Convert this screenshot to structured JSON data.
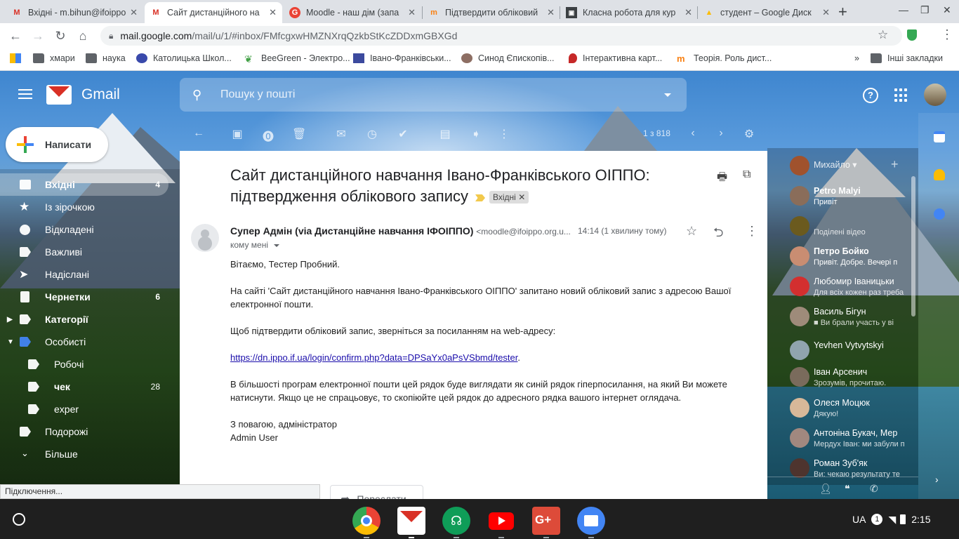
{
  "tabs": [
    {
      "title": "Вхідні - m.bihun@ifoippo",
      "icon": "gmail-icon",
      "active": false
    },
    {
      "title": "Сайт дистанційного на",
      "icon": "gmail-icon",
      "active": true
    },
    {
      "title": "Moodle - наш дім (запа",
      "icon": "google-icon",
      "active": false
    },
    {
      "title": "Підтвердити обліковий",
      "icon": "moodle-icon",
      "active": false
    },
    {
      "title": "Класна робота для кур",
      "icon": "classroom-icon",
      "active": false
    },
    {
      "title": "студент – Google Диск",
      "icon": "drive-icon",
      "active": false
    }
  ],
  "address": {
    "host": "mail.google.com",
    "path": "/mail/u/1/#inbox/FMfcgxwHMZNXrqQzkbStKcZDDxmGBXGd"
  },
  "bookmarks": [
    "хмари",
    "наука",
    "Католицька Школ...",
    "BeeGreen - Электро...",
    "Івано-Франківськи...",
    "Синод Єпископів...",
    "Інтерактивна карт...",
    "Теорія. Роль дист...",
    "Інші закладки"
  ],
  "gmail": {
    "brand": "Gmail",
    "search_placeholder": "Пошук у пошті",
    "compose_label": "Написати",
    "pager": "1 з 818",
    "nav": [
      {
        "label": "Вхідні",
        "count": "4",
        "icon": "inbox-icon",
        "selected": true
      },
      {
        "label": "Із зірочкою",
        "count": "",
        "icon": "star-icon"
      },
      {
        "label": "Відкладені",
        "count": "",
        "icon": "clock-icon"
      },
      {
        "label": "Важливі",
        "count": "",
        "icon": "label-icon"
      },
      {
        "label": "Надіслані",
        "count": "",
        "icon": "send-icon"
      },
      {
        "label": "Чернетки",
        "count": "6",
        "icon": "draft-icon",
        "bold": true
      },
      {
        "label": "Категорії",
        "count": "",
        "icon": "label-icon",
        "bold": true
      },
      {
        "label": "Особисті",
        "count": "",
        "icon": "label-icon"
      },
      {
        "label": "Робочі",
        "count": "",
        "icon": "label-icon"
      },
      {
        "label": "чек",
        "count": "28",
        "icon": "label-icon",
        "bold": true
      },
      {
        "label": "exper",
        "count": "",
        "icon": "label-icon"
      },
      {
        "label": "Подорожі",
        "count": "",
        "icon": "label-icon"
      },
      {
        "label": "Більше",
        "count": "",
        "icon": "chevron-down-icon"
      }
    ]
  },
  "message": {
    "subject": "Сайт дистанційного навчання Івано-Франківського ОІППО: підтвердження облікового запису",
    "label_chip": "Вхідні",
    "sender_name": "Супер Адмін (via Дистанційне навчання ІФОІППО)",
    "sender_email": "<moodle@ifoippo.org.u...",
    "time": "14:14 (1 хвилину тому)",
    "to": "кому мені",
    "greeting": "Вітаємо, Тестер Пробний.",
    "p1": "На сайті 'Сайт дистанційного навчання Івано-Франківського ОІППО' запитано новий обліковий запис з адресою Вашої електронної пошти.",
    "p2": "Щоб підтвердити обліковий запис, зверніться за посиланням на web-адресу:",
    "link": "https://dn.ippo.if.ua/login/confirm.php?data=DPSaYx0aPsVSbmd/tester",
    "p3": "В більшості програм електронної пошти цей рядок буде виглядати як синій рядок гіперпосилання, на який Ви можете натиснути. Якщо це не спрацьовує, то скопіюйте цей рядок до адресного рядка вашого інтернет оглядача.",
    "regards": "З повагою, адміністратор",
    "signature": "Admin User",
    "forward_label": "Переслати"
  },
  "chat": {
    "me": "Михайло",
    "contacts": [
      {
        "name": "Petro Malyi",
        "status": "Привіт",
        "bold": true
      },
      {
        "name": "",
        "status": "Поділені відео",
        "bold": false
      },
      {
        "name": "Петро Бойко",
        "status": "Привіт. Добре. Вечері п",
        "bold": true
      },
      {
        "name": "Любомир Іваницьки",
        "status": "Для всіх кожен раз треба",
        "bold": false
      },
      {
        "name": "Василь Бігун",
        "status": "Ви брали участь у ві",
        "bold": false
      },
      {
        "name": "Yevhen Vytvytskyi",
        "status": "",
        "bold": false
      },
      {
        "name": "Іван Арсенич",
        "status": "Зрозумів, прочитаю.",
        "bold": false
      },
      {
        "name": "Олеся Моцюк",
        "status": "Дякую!",
        "bold": false
      },
      {
        "name": "Антоніна Букач, Мер",
        "status": "Мердух Іван: ми забули п",
        "bold": false
      },
      {
        "name": "Роман Зуб'як",
        "status": "Ви: чекаю результату те",
        "bold": false
      }
    ]
  },
  "status_text": "Підключення...",
  "shelf": {
    "lang": "UA",
    "notifications": "1",
    "clock": "2:15"
  }
}
